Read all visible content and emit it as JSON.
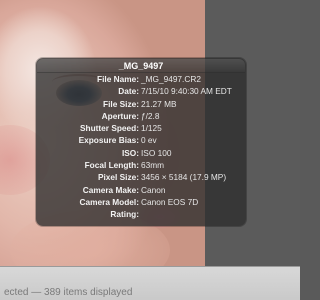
{
  "hud": {
    "title": "_MG_9497",
    "rows": [
      {
        "label": "File Name:",
        "value": "_MG_9497.CR2"
      },
      {
        "label": "Date:",
        "value": "7/15/10 9:40:30 AM EDT"
      },
      {
        "label": "File Size:",
        "value": "21.27 MB"
      },
      {
        "label": "Aperture:",
        "value": "ƒ/2.8"
      },
      {
        "label": "Shutter Speed:",
        "value": "1/125"
      },
      {
        "label": "Exposure Bias:",
        "value": "0 ev"
      },
      {
        "label": "ISO:",
        "value": "ISO 100"
      },
      {
        "label": "Focal Length:",
        "value": "63mm"
      },
      {
        "label": "Pixel Size:",
        "value": "3456 × 5184 (17.9 MP)"
      },
      {
        "label": "Camera Make:",
        "value": "Canon"
      },
      {
        "label": "Camera Model:",
        "value": "Canon EOS 7D"
      },
      {
        "label": "Rating:",
        "value": ""
      }
    ]
  },
  "status_bar": {
    "text": "ected — 389 items displayed"
  },
  "colors": {
    "hud_background": "#2d2d2d",
    "canvas_background": "#5b5b5b",
    "status_bar": "#d0d0d0"
  }
}
